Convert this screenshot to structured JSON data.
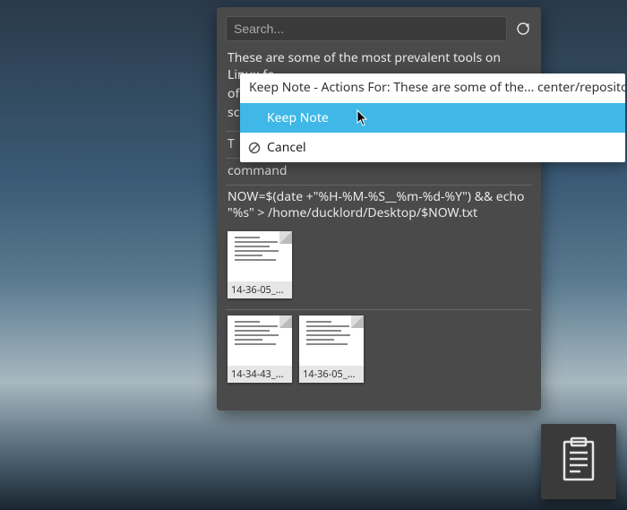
{
  "search": {
    "placeholder": "Search..."
  },
  "sections": {
    "top_text": "These are some of the most prevalent tools on Linux fo",
    "mid_text": "of",
    "low_text": "sc",
    "t_label": "T",
    "command_label": "command",
    "command_text": "NOW=$(date +\"%H-%M-%S__%m-%d-%Y\") && echo \"%s\" > /home/ducklord/Desktop/$NOW.txt"
  },
  "thumbs1": [
    {
      "label": "14-36-05_..."
    }
  ],
  "thumbs2": [
    {
      "label": "14-34-43_..."
    },
    {
      "label": "14-36-05_..."
    }
  ],
  "context": {
    "title": "Keep Note - Actions For: These are some of the... center/repositories.",
    "items": [
      {
        "label": "Keep Note",
        "active": true
      },
      {
        "label": "Cancel",
        "active": false
      }
    ]
  }
}
